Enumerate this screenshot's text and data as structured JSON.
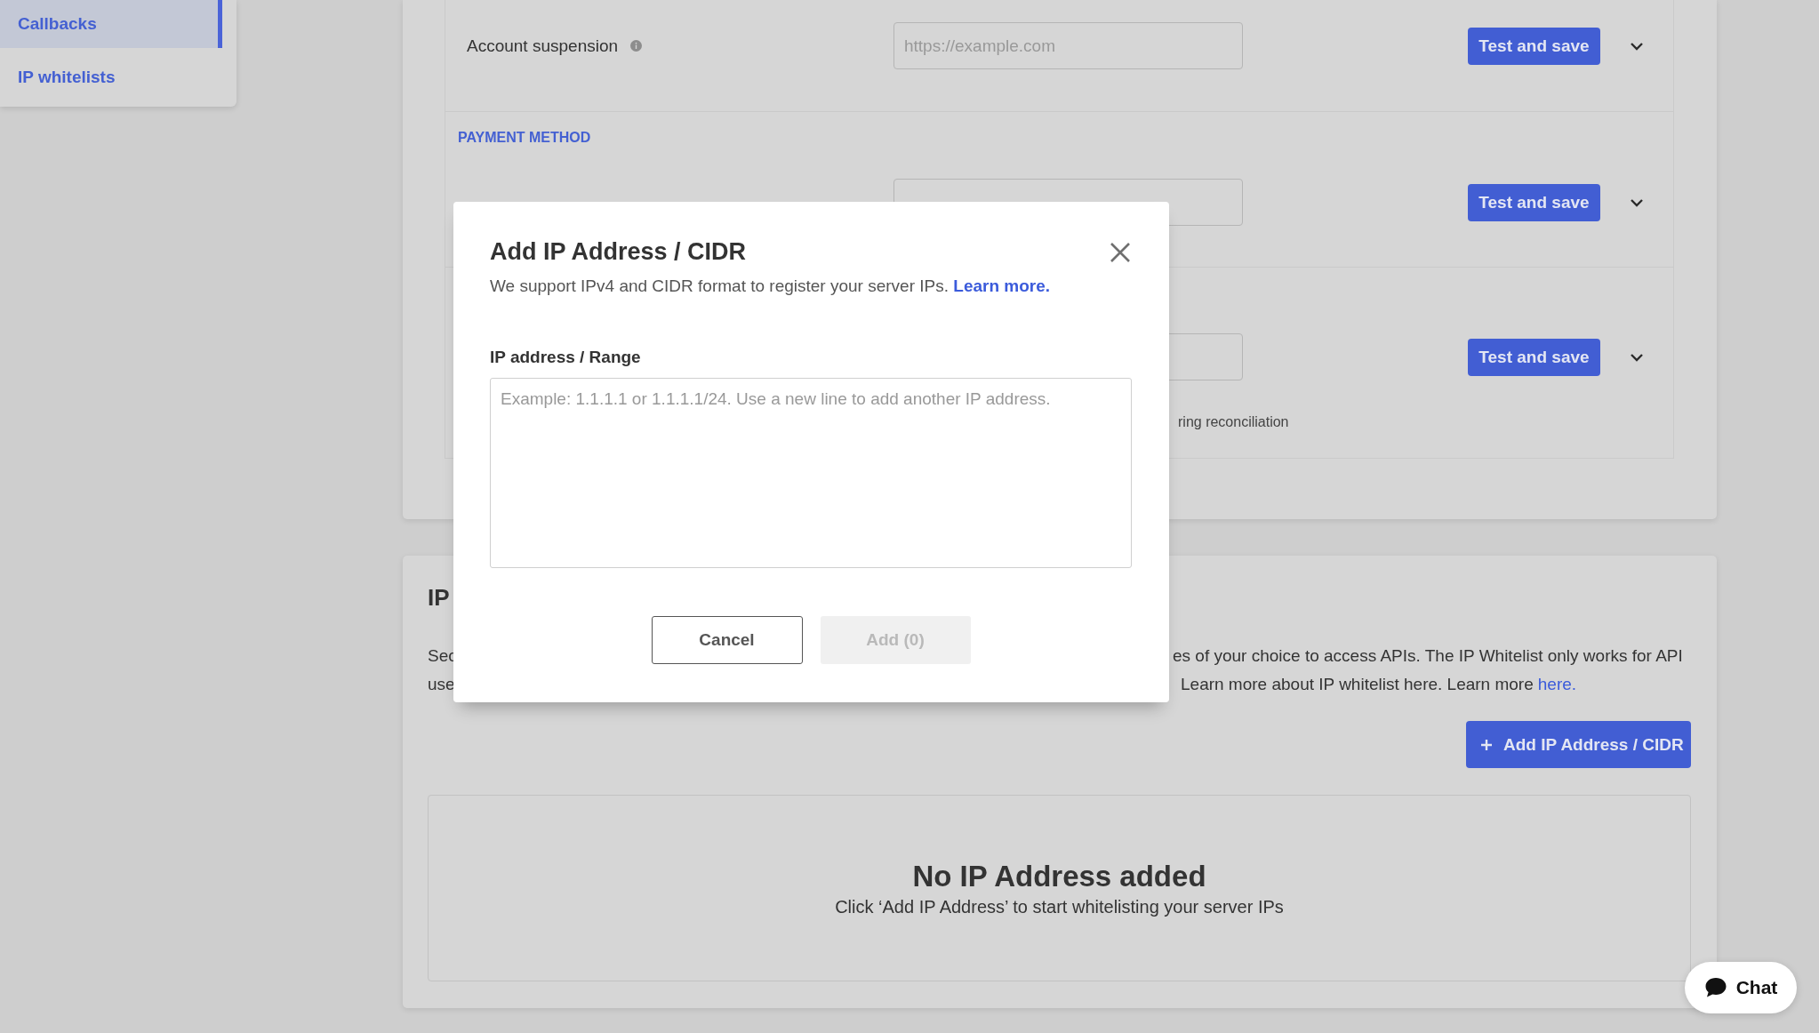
{
  "sidebar": {
    "items": [
      {
        "label": "Callbacks",
        "selected": true
      },
      {
        "label": "IP whitelists",
        "selected": false
      }
    ]
  },
  "callbacks": {
    "groups": [
      {
        "rows": [
          {
            "label": "Account suspension",
            "placeholder": "https://example.com",
            "button": "Test and save"
          }
        ]
      },
      {
        "heading": "PAYMENT METHOD",
        "rows": [
          {
            "button": "Test and save"
          }
        ]
      },
      {
        "rows": [
          {
            "button": "Test and save",
            "note": "ring reconciliation"
          }
        ]
      }
    ]
  },
  "ip_whitelist": {
    "title": "IP",
    "description_lines": [
      {
        "left": "Sec",
        "right": "es of your choice to access APIs. The IP Whitelist only works for API"
      },
      {
        "left": "use",
        "right": "Learn more about IP whitelist here. Learn more",
        "link": "here."
      }
    ],
    "add_button": "Add IP Address / CIDR",
    "empty_state": {
      "title": "No IP Address added",
      "text": "Click ‘Add IP Address’ to start whitelisting your server IPs"
    }
  },
  "modal": {
    "title": "Add IP Address / CIDR",
    "text": "We support IPv4 and CIDR format to register your server IPs.",
    "link": "Learn more.",
    "field_label": "IP address / Range",
    "placeholder": "Example: 1.1.1.1 or 1.1.1.1/24. Use a new line to add another IP address.",
    "cancel": "Cancel",
    "add": {
      "label": "Add (0)",
      "disabled": true
    }
  },
  "chat": {
    "label": "Chat"
  }
}
